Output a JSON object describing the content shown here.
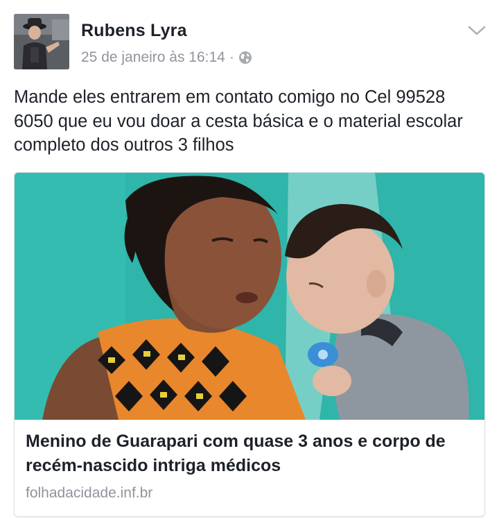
{
  "post": {
    "author": "Rubens Lyra",
    "timestamp": "25 de janeiro às 16:14",
    "separator": "·",
    "privacy_icon": "globe-icon",
    "menu_icon": "chevron-down-icon",
    "message": "Mande eles entrarem em contato comigo no Cel 99528 6050 que eu vou doar a cesta básica e o material escolar completo dos outros 3 filhos"
  },
  "link_preview": {
    "image": "photo of a woman holding a small child",
    "title": "Menino de Guarapari com quase 3 anos e corpo de recém-nascido intriga médicos",
    "domain": "folhadacidade.inf.br"
  },
  "colors": {
    "text": "#1d2129",
    "secondary_text": "#90949c",
    "card_border": "#dddfe2",
    "image_background": "#2fb5aa"
  }
}
